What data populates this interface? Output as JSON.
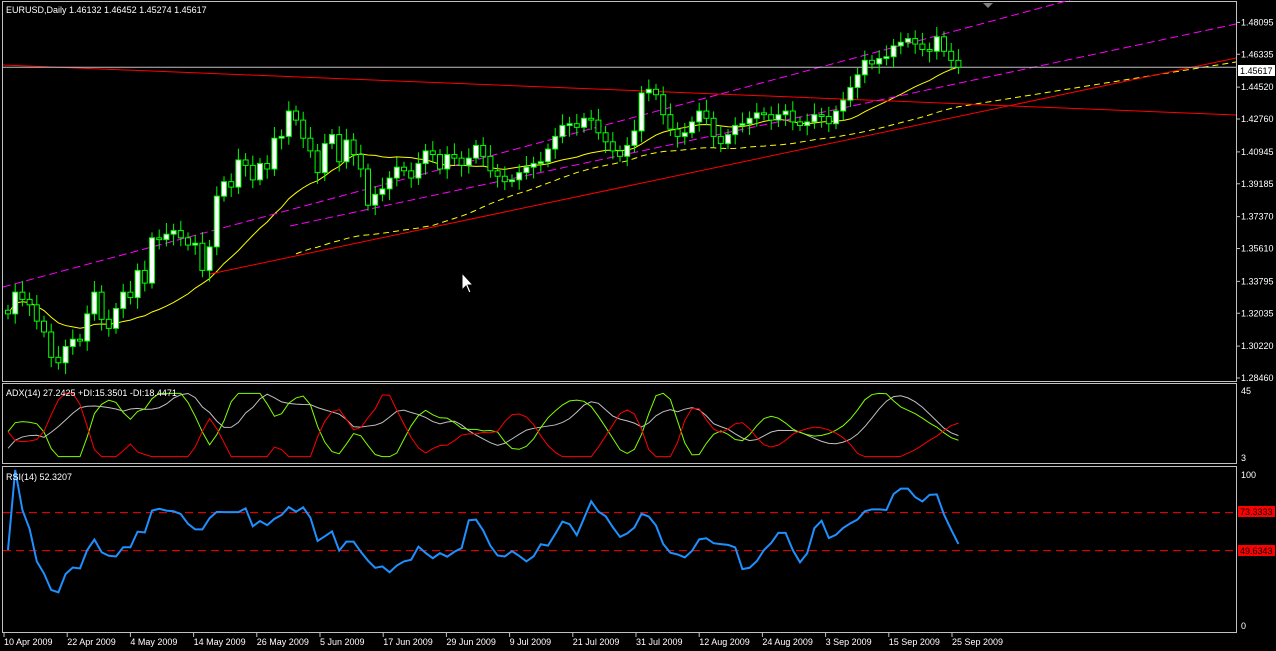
{
  "main_panel": {
    "header": "EURUSD,Daily  1.46132 1.46452 1.45274 1.45617",
    "y_ticks": [
      "1.48095",
      "1.46335",
      "1.44520",
      "1.42760",
      "1.40945",
      "1.39185",
      "1.37370",
      "1.35610",
      "1.33795",
      "1.32035",
      "1.30220",
      "1.28460"
    ],
    "current_price": "1.45617"
  },
  "adx_panel": {
    "header": "ADX(14) 27.2425 +DI:15.3501 -DI:18.4471",
    "y_top": "45",
    "y_bottom": "3"
  },
  "rsi_panel": {
    "header": "RSI(14) 52.3207",
    "y_top": "100",
    "y_bottom": "0",
    "level_upper": "73.3333",
    "level_lower": "49.6343"
  },
  "x_axis": {
    "labels": [
      "10 Apr 2009",
      "22 Apr 2009",
      "4 May 2009",
      "14 May 2009",
      "26 May 2009",
      "5 Jun 2009",
      "17 Jun 2009",
      "29 Jun 2009",
      "9 Jul 2009",
      "21 Jul 2009",
      "31 Jul 2009",
      "12 Aug 2009",
      "24 Aug 2009",
      "3 Sep 2009",
      "15 Sep 2009",
      "25 Sep 2009"
    ]
  },
  "colors": {
    "background": "#000000",
    "grid_border": "#c0c0c0",
    "candle": "#00ff00",
    "trendline": "#ff0000",
    "channel": "#ff00ff",
    "ma_fast": "#ffff00",
    "ma_slow_dashed": "#ffff00",
    "adx": "#c0c0c0",
    "plus_di": "#7fff00",
    "minus_di": "#ff0000",
    "rsi": "#1e90ff",
    "rsi_levels": "#ff0000"
  },
  "chart_data": {
    "type": "candlestick",
    "symbol": "EURUSD",
    "timeframe": "Daily",
    "last_bar": {
      "open": 1.46132,
      "high": 1.46452,
      "low": 1.45274,
      "close": 1.45617
    },
    "ylim": [
      1.2846,
      1.49
    ],
    "close_series": [
      1.32,
      1.332,
      1.328,
      1.325,
      1.316,
      1.31,
      1.296,
      1.293,
      1.302,
      1.306,
      1.305,
      1.32,
      1.332,
      1.317,
      1.312,
      1.323,
      1.332,
      1.329,
      1.344,
      1.337,
      1.362,
      1.361,
      1.364,
      1.366,
      1.362,
      1.358,
      1.359,
      1.344,
      1.357,
      1.385,
      1.393,
      1.39,
      1.405,
      1.402,
      1.394,
      1.403,
      1.4,
      1.417,
      1.418,
      1.432,
      1.427,
      1.417,
      1.41,
      1.398,
      1.414,
      1.419,
      1.404,
      1.416,
      1.408,
      1.4,
      1.38,
      1.386,
      1.389,
      1.395,
      1.401,
      1.399,
      1.395,
      1.403,
      1.41,
      1.408,
      1.4,
      1.408,
      1.406,
      1.402,
      1.406,
      1.413,
      1.407,
      1.399,
      1.396,
      1.393,
      1.394,
      1.398,
      1.401,
      1.403,
      1.404,
      1.411,
      1.418,
      1.424,
      1.425,
      1.423,
      1.428,
      1.427,
      1.42,
      1.415,
      1.41,
      1.407,
      1.413,
      1.421,
      1.442,
      1.444,
      1.441,
      1.43,
      1.422,
      1.418,
      1.42,
      1.426,
      1.432,
      1.428,
      1.418,
      1.414,
      1.419,
      1.424,
      1.425,
      1.428,
      1.431,
      1.43,
      1.427,
      1.43,
      1.432,
      1.426,
      1.424,
      1.426,
      1.43,
      1.429,
      1.425,
      1.432,
      1.438,
      1.445,
      1.452,
      1.46,
      1.458,
      1.461,
      1.462,
      1.468,
      1.47,
      1.472,
      1.469,
      1.466,
      1.465,
      1.473,
      1.465,
      1.46,
      1.4562
    ],
    "rsi": {
      "value": 52.3207,
      "levels": [
        73.3333,
        49.6343
      ],
      "range": [
        0,
        100
      ]
    },
    "adx": {
      "adx": 27.2425,
      "plus_di": 15.3501,
      "minus_di": 18.4471,
      "range": [
        3,
        45
      ]
    }
  }
}
